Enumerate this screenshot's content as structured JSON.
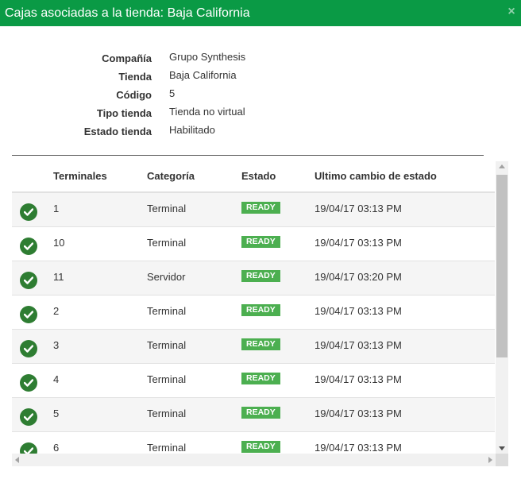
{
  "dialog": {
    "title": "Cajas asociadas a la tienda: Baja California",
    "close_symbol": "×",
    "accent_color": "#0a9a45"
  },
  "info": [
    {
      "label": "Compañía",
      "value": "Grupo Synthesis"
    },
    {
      "label": "Tienda",
      "value": "Baja California"
    },
    {
      "label": "Código",
      "value": "5"
    },
    {
      "label": "Tipo tienda",
      "value": "Tienda no virtual"
    },
    {
      "label": "Estado tienda",
      "value": "Habilitado"
    }
  ],
  "table": {
    "headers": [
      "Terminales",
      "Categoría",
      "Estado",
      "Ultimo cambio de estado"
    ],
    "rows": [
      {
        "terminal": "1",
        "categoria": "Terminal",
        "estado": "READY",
        "fecha": "19/04/17 03:13 PM"
      },
      {
        "terminal": "10",
        "categoria": "Terminal",
        "estado": "READY",
        "fecha": "19/04/17 03:13 PM"
      },
      {
        "terminal": "11",
        "categoria": "Servidor",
        "estado": "READY",
        "fecha": "19/04/17 03:20 PM"
      },
      {
        "terminal": "2",
        "categoria": "Terminal",
        "estado": "READY",
        "fecha": "19/04/17 03:13 PM"
      },
      {
        "terminal": "3",
        "categoria": "Terminal",
        "estado": "READY",
        "fecha": "19/04/17 03:13 PM"
      },
      {
        "terminal": "4",
        "categoria": "Terminal",
        "estado": "READY",
        "fecha": "19/04/17 03:13 PM"
      },
      {
        "terminal": "5",
        "categoria": "Terminal",
        "estado": "READY",
        "fecha": "19/04/17 03:13 PM"
      },
      {
        "terminal": "6",
        "categoria": "Terminal",
        "estado": "READY",
        "fecha": "19/04/17 03:13 PM"
      }
    ],
    "status_icon": "check-circle-icon",
    "status_badge_color": "#4caf50"
  }
}
